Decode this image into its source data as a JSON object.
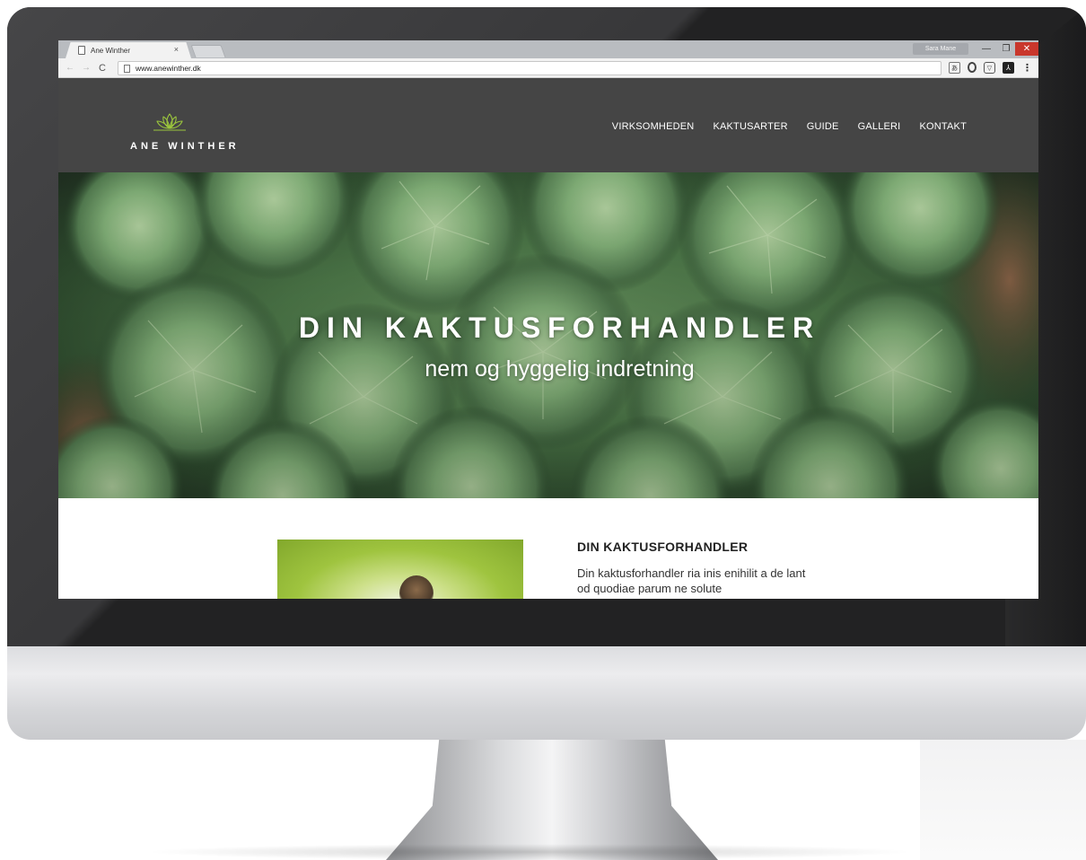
{
  "browser": {
    "tab_title": "Ane Winther",
    "tab_close": "×",
    "url": "www.anewinther.dk",
    "profile_name": "Sara Mane",
    "window_controls": {
      "minimize": "—",
      "maximize": "❐",
      "close": "✕"
    },
    "nav": {
      "back": "←",
      "forward": "→",
      "reload": "C"
    },
    "extensions": [
      "translate-icon",
      "opera-icon",
      "pocket-icon",
      "acrobat-icon",
      "menu-icon"
    ]
  },
  "site": {
    "logo_text": "ANE WINTHER",
    "accent_color": "#9bc53d",
    "header_color": "#454545",
    "nav": [
      "VIRKSOMHEDEN",
      "KAKTUSARTER",
      "GUIDE",
      "GALLERI",
      "KONTAKT"
    ],
    "hero": {
      "title": "DIN KAKTUSFORHANDLER",
      "subtitle": "nem og hyggelig indretning"
    },
    "section": {
      "heading": "DIN KAKTUSFORHANDLER",
      "body": "Din kaktusforhandler ria inis enihilit a de lant od quodiae parum ne solute"
    }
  }
}
